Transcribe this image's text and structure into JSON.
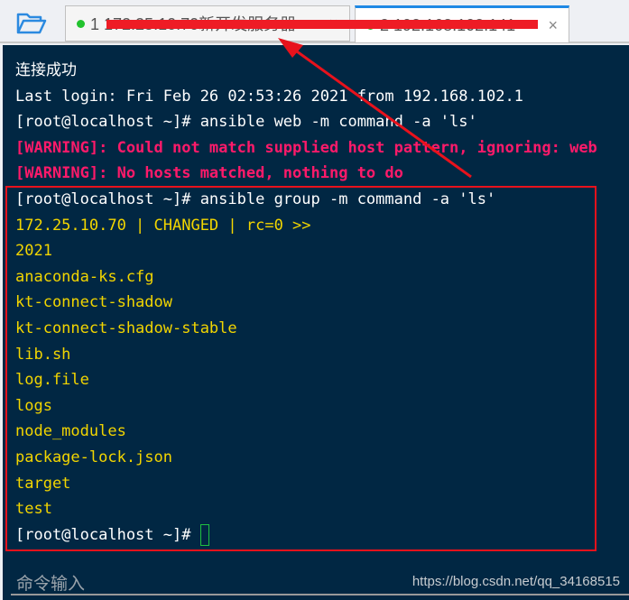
{
  "tabs": [
    {
      "label": "1 172.25.10.70新开发服务器",
      "status_color": "#22c32e"
    },
    {
      "label": "2 192.168.102.141",
      "status_color": "#22c32e",
      "active": true
    }
  ],
  "terminal": {
    "lines": [
      {
        "text": "连接成功",
        "style": "w"
      },
      {
        "text": "Last login: Fri Feb 26 02:53:26 2021 from 192.168.102.1",
        "style": "w"
      },
      {
        "text": "[root@localhost ~]# ansible web -m command -a 'ls'",
        "style": "w"
      },
      {
        "text": "[WARNING]: Could not match supplied host pattern, ignoring: web",
        "style": "warn"
      },
      {
        "text": "[WARNING]: No hosts matched, nothing to do",
        "style": "warn"
      },
      {
        "text": "[root@localhost ~]# ansible group -m command -a 'ls'",
        "style": "w"
      },
      {
        "text": "172.25.10.70 | CHANGED | rc=0 >>",
        "style": "y"
      },
      {
        "text": "2021",
        "style": "y"
      },
      {
        "text": "anaconda-ks.cfg",
        "style": "y"
      },
      {
        "text": "kt-connect-shadow",
        "style": "y"
      },
      {
        "text": "kt-connect-shadow-stable",
        "style": "y"
      },
      {
        "text": "lib.sh",
        "style": "y"
      },
      {
        "text": "log.file",
        "style": "y"
      },
      {
        "text": "logs",
        "style": "y"
      },
      {
        "text": "node_modules",
        "style": "y"
      },
      {
        "text": "package-lock.json",
        "style": "y"
      },
      {
        "text": "target",
        "style": "y"
      },
      {
        "text": "test",
        "style": "y"
      }
    ],
    "prompt": "[root@localhost ~]# "
  },
  "command_input_label": "命令输入",
  "watermark": "https://blog.csdn.net/qq_34168515",
  "colors": {
    "terminal_bg": "#012743",
    "warning": "#ff1a6a",
    "output": "#f2d500",
    "annotation": "#e8121c"
  }
}
